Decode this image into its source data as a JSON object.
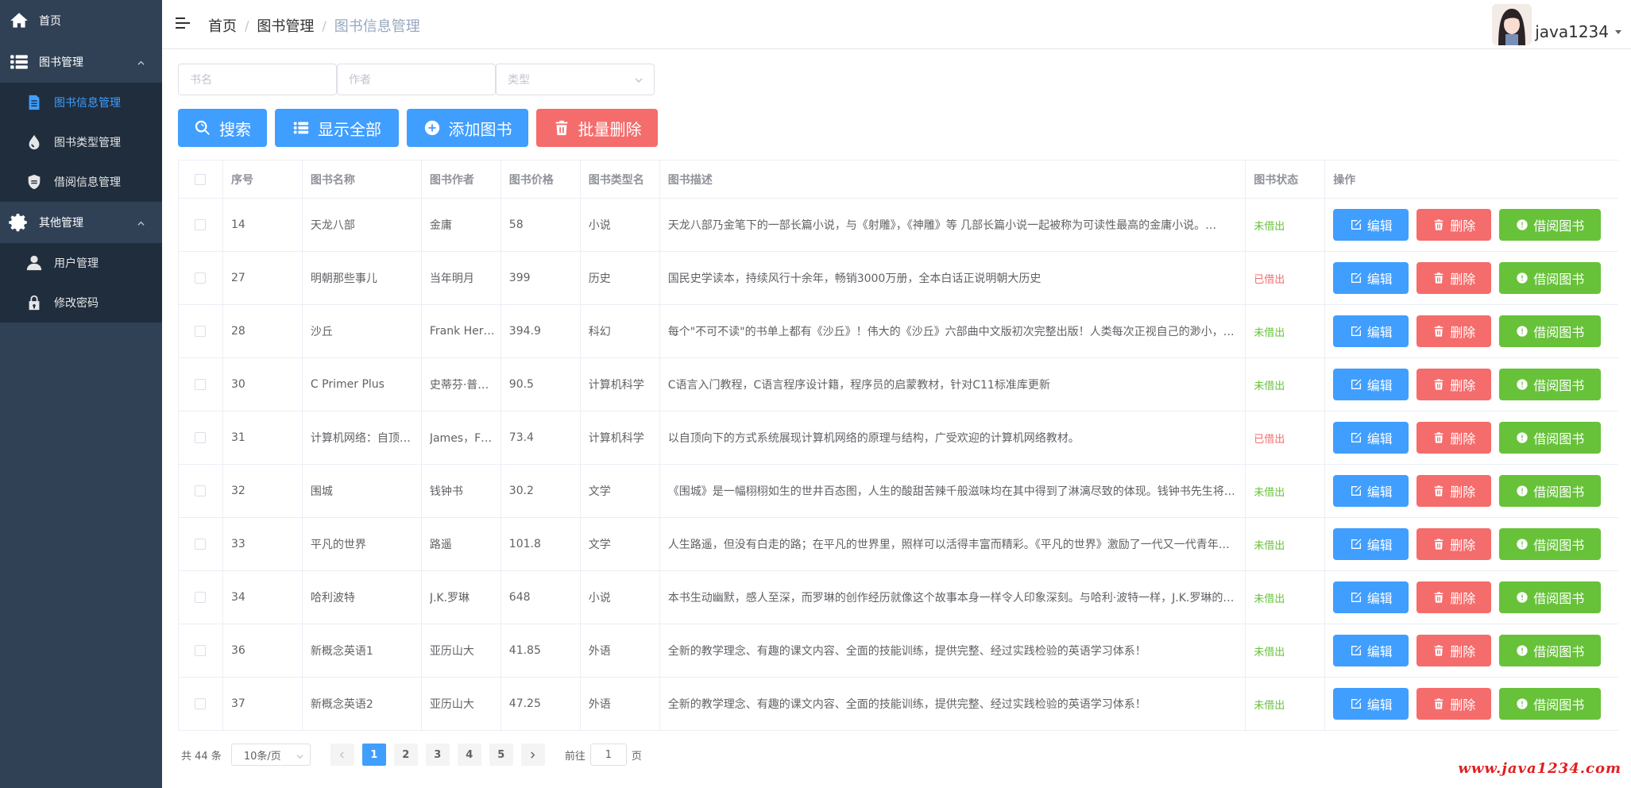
{
  "sidebar": {
    "home": "首页",
    "book_mgmt": "图书管理",
    "book_info": "图书信息管理",
    "book_type": "图书类型管理",
    "borrow_info": "借阅信息管理",
    "other_mgmt": "其他管理",
    "user_mgmt": "用户管理",
    "change_pwd": "修改密码"
  },
  "header": {
    "breadcrumb": [
      "首页",
      "图书管理",
      "图书信息管理"
    ],
    "username": "java1234"
  },
  "filters": {
    "name_placeholder": "书名",
    "author_placeholder": "作者",
    "type_placeholder": "类型"
  },
  "actions": {
    "search": "搜索",
    "show_all": "显示全部",
    "add": "添加图书",
    "batch_delete": "批量删除"
  },
  "table": {
    "headers": [
      "序号",
      "图书名称",
      "图书作者",
      "图书价格",
      "图书类型名",
      "图书描述",
      "图书状态",
      "操作"
    ],
    "op_labels": {
      "edit": "编辑",
      "delete": "删除",
      "borrow": "借阅图书"
    },
    "rows": [
      {
        "id": "14",
        "name": "天龙八部",
        "author": "金庸",
        "price": "58",
        "type": "小说",
        "desc": "天龙八部乃金笔下的一部长篇小说，与《射雕》，《神雕》等 几部长篇小说一起被称为可读性最高的金庸小说。…",
        "status": "未借出"
      },
      {
        "id": "27",
        "name": "明朝那些事儿",
        "author": "当年明月",
        "price": "399",
        "type": "历史",
        "desc": "国民史学读本，持续风行十余年，畅销3000万册，全本白话正说明朝大历史",
        "status": "已借出"
      },
      {
        "id": "28",
        "name": "沙丘",
        "author": "Frank Her…",
        "price": "394.9",
        "type": "科幻",
        "desc": "每个\"不可不读\"的书单上都有《沙丘》！伟大的《沙丘》六部曲中文版初次完整出版！人类每次正视自己的渺小，…",
        "status": "未借出"
      },
      {
        "id": "30",
        "name": "C Primer Plus",
        "author": "史蒂芬·普…",
        "price": "90.5",
        "type": "计算机科学",
        "desc": "C语言入门教程，C语言程序设计籍，程序员的启蒙教材，针对C11标准库更新",
        "status": "未借出"
      },
      {
        "id": "31",
        "name": "计算机网络：自顶…",
        "author": "James，F…",
        "price": "73.4",
        "type": "计算机科学",
        "desc": "以自顶向下的方式系统展现计算机网络的原理与结构，广受欢迎的计算机网络教材。",
        "status": "已借出"
      },
      {
        "id": "32",
        "name": "围城",
        "author": "钱钟书",
        "price": "30.2",
        "type": "文学",
        "desc": "《围城》是一幅栩栩如生的世井百态图，人生的酸甜苦辣千般滋味均在其中得到了淋漓尽致的体现。钱钟书先生将…",
        "status": "未借出"
      },
      {
        "id": "33",
        "name": "平凡的世界",
        "author": "路遥",
        "price": "101.8",
        "type": "文学",
        "desc": "人生路遥，但没有白走的路；在平凡的世界里，照样可以活得丰富而精彩。《平凡的世界》激励了一代又一代青年…",
        "status": "未借出"
      },
      {
        "id": "34",
        "name": "哈利波特",
        "author": "J.K.罗琳",
        "price": "648",
        "type": "小说",
        "desc": "本书生动幽默，感人至深，而罗琳的创作经历就像这个故事本身一样令人印象深刻。与哈利·波特一样，J.K.罗琳的…",
        "status": "未借出"
      },
      {
        "id": "36",
        "name": "新概念英语1",
        "author": "亚历山大",
        "price": "41.85",
        "type": "外语",
        "desc": "全新的教学理念、有趣的课文内容、全面的技能训练，提供完整、经过实践检验的英语学习体系！",
        "status": "未借出"
      },
      {
        "id": "37",
        "name": "新概念英语2",
        "author": "亚历山大",
        "price": "47.25",
        "type": "外语",
        "desc": "全新的教学理念、有趣的课文内容、全面的技能训练，提供完整、经过实践检验的英语学习体系！",
        "status": "未借出"
      }
    ]
  },
  "pagination": {
    "total": "共 44 条",
    "page_size": "10条/页",
    "pages": [
      "1",
      "2",
      "3",
      "4",
      "5"
    ],
    "current": "1",
    "goto_prefix": "前往",
    "goto_value": "1",
    "goto_suffix": "页"
  },
  "watermark": "www.java1234.com",
  "colors": {
    "primary": "#409eff",
    "danger": "#f56c6c",
    "success": "#67c23a",
    "sidebar_bg": "#304156",
    "submenu_bg": "#1f2d3d"
  }
}
